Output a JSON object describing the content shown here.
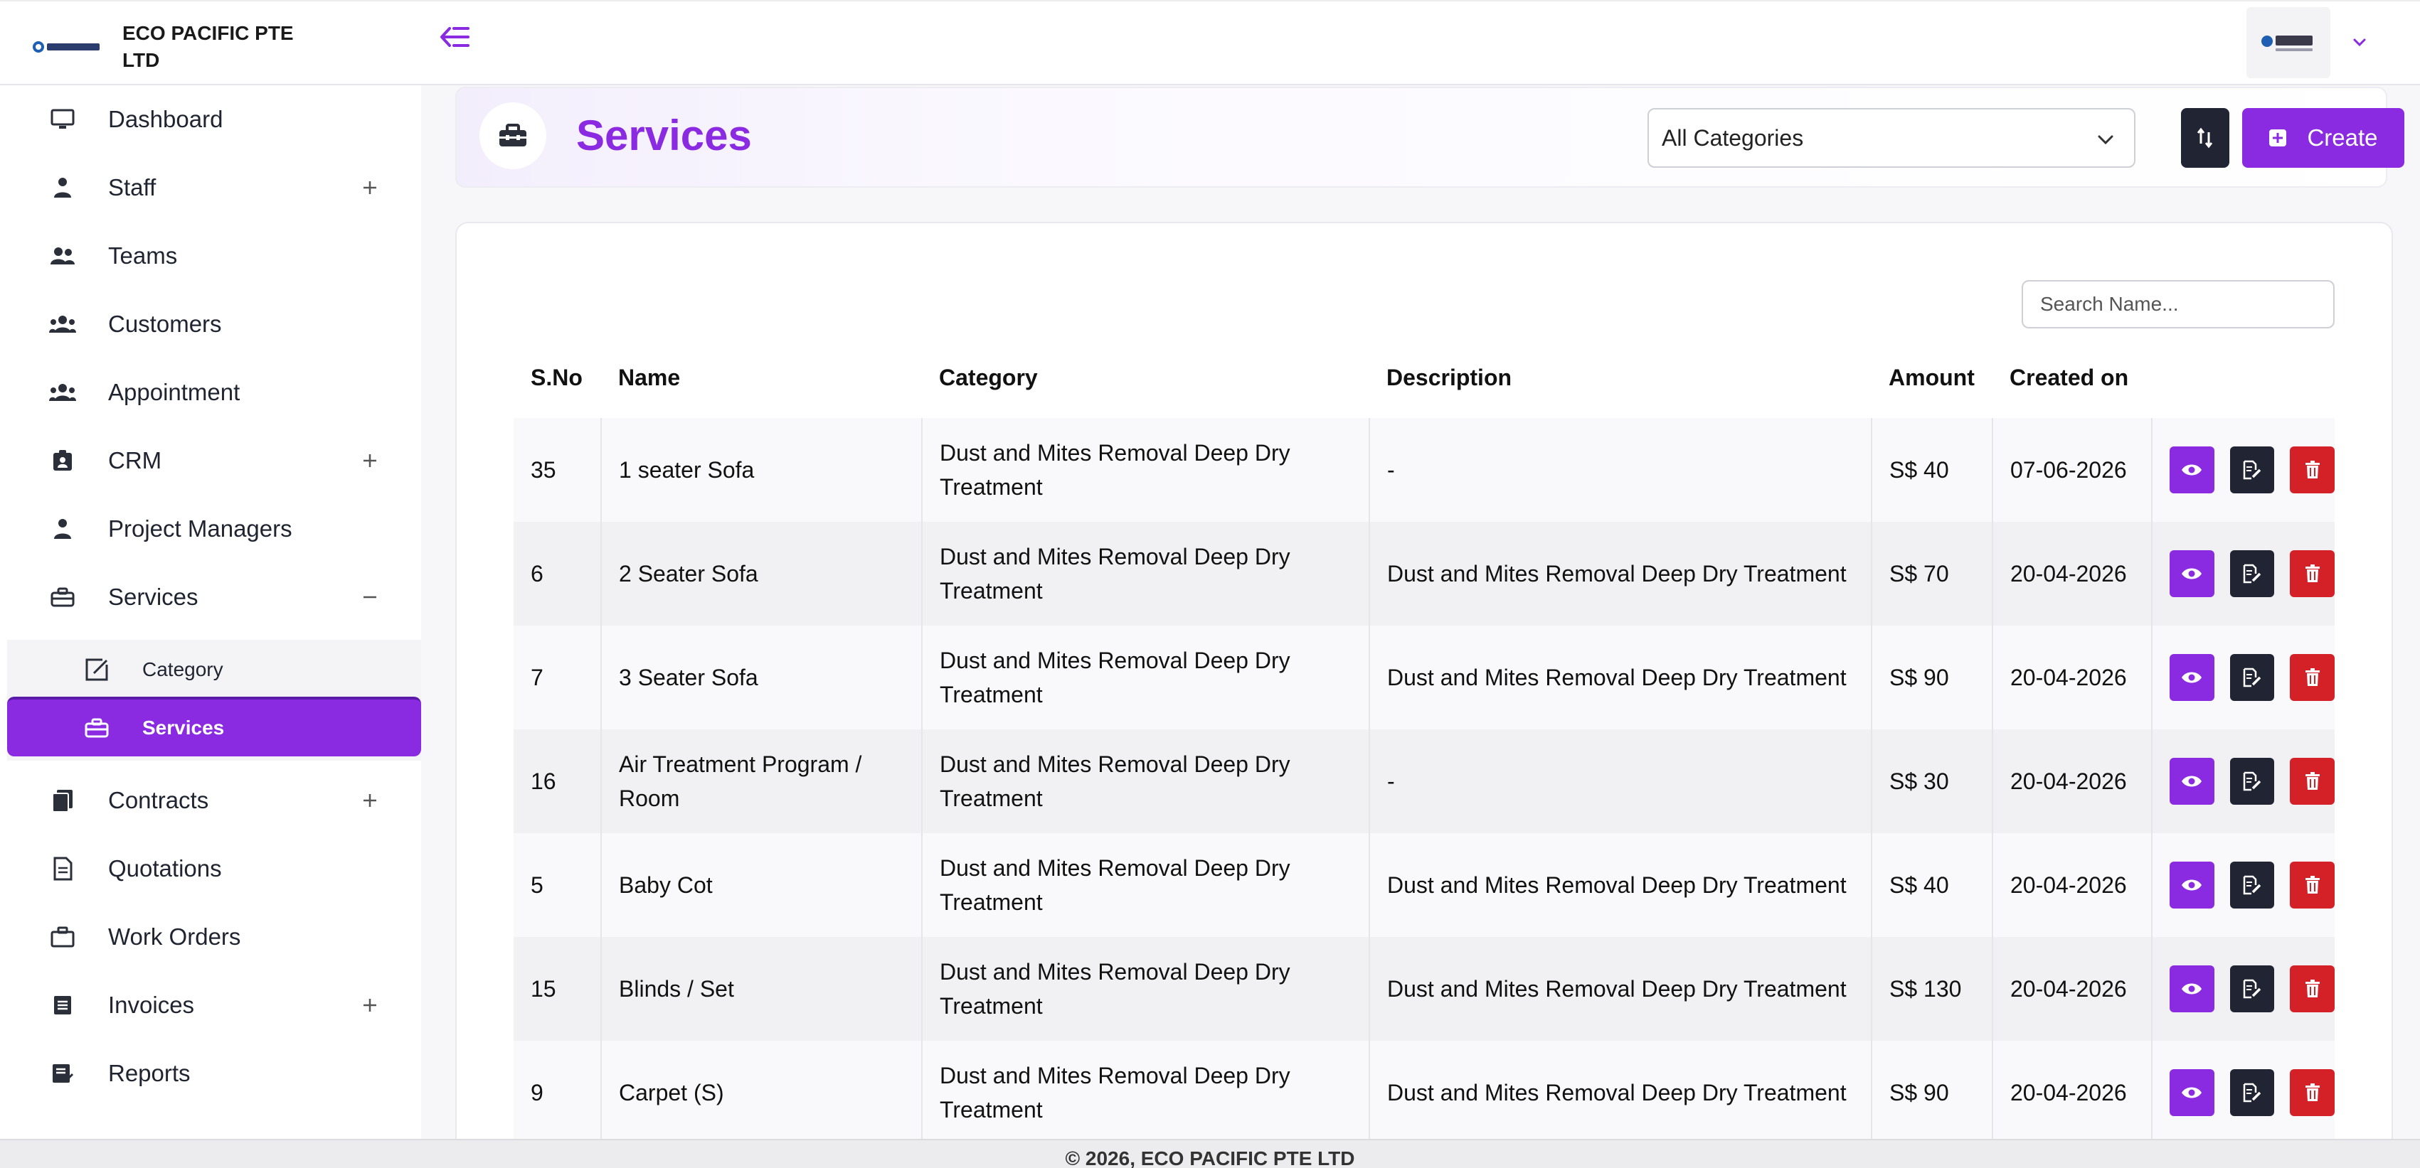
{
  "brand": {
    "name": "ECO PACIFIC PTE LTD"
  },
  "sidebar": {
    "items": [
      {
        "label": "Dashboard",
        "icon": "monitor-icon"
      },
      {
        "label": "Staff",
        "icon": "person-icon",
        "toggle": "+"
      },
      {
        "label": "Teams",
        "icon": "people-icon"
      },
      {
        "label": "Customers",
        "icon": "group-icon"
      },
      {
        "label": "Appointment",
        "icon": "group-icon"
      },
      {
        "label": "CRM",
        "icon": "id-badge-icon",
        "toggle": "+"
      },
      {
        "label": "Project Managers",
        "icon": "person-icon"
      },
      {
        "label": "Services",
        "icon": "toolbox-icon",
        "toggle": "−"
      },
      {
        "label": "Contracts",
        "icon": "documents-icon",
        "toggle": "+"
      },
      {
        "label": "Quotations",
        "icon": "file-icon"
      },
      {
        "label": "Work Orders",
        "icon": "briefcase-icon"
      },
      {
        "label": "Invoices",
        "icon": "list-icon",
        "toggle": "+"
      },
      {
        "label": "Reports",
        "icon": "report-icon"
      }
    ],
    "submenu": [
      {
        "label": "Category",
        "icon": "edit-square-icon"
      },
      {
        "label": "Services",
        "icon": "toolbox-icon",
        "active": true
      }
    ]
  },
  "header": {
    "title": "Services",
    "category_select": {
      "value": "All Categories"
    },
    "create_label": "Create"
  },
  "search": {
    "placeholder": "Search Name..."
  },
  "table": {
    "columns": [
      "S.No",
      "Name",
      "Category",
      "Description",
      "Amount",
      "Created on"
    ],
    "rows": [
      {
        "sno": "35",
        "name": "1 seater Sofa",
        "category": "Dust and Mites Removal Deep Dry Treatment",
        "description": "-",
        "amount": "S$ 40",
        "created": "07-06-2026"
      },
      {
        "sno": "6",
        "name": "2 Seater Sofa",
        "category": "Dust and Mites Removal Deep Dry Treatment",
        "description": "Dust and Mites Removal Deep Dry Treatment",
        "amount": "S$ 70",
        "created": "20-04-2026"
      },
      {
        "sno": "7",
        "name": "3 Seater Sofa",
        "category": "Dust and Mites Removal Deep Dry Treatment",
        "description": "Dust and Mites Removal Deep Dry Treatment",
        "amount": "S$ 90",
        "created": "20-04-2026"
      },
      {
        "sno": "16",
        "name": "Air Treatment Program / Room",
        "category": "Dust and Mites Removal Deep Dry Treatment",
        "description": "-",
        "amount": "S$ 30",
        "created": "20-04-2026"
      },
      {
        "sno": "5",
        "name": "Baby Cot",
        "category": "Dust and Mites Removal Deep Dry Treatment",
        "description": "Dust and Mites Removal Deep Dry Treatment",
        "amount": "S$ 40",
        "created": "20-04-2026"
      },
      {
        "sno": "15",
        "name": "Blinds / Set",
        "category": "Dust and Mites Removal Deep Dry Treatment",
        "description": "Dust and Mites Removal Deep Dry Treatment",
        "amount": "S$ 130",
        "created": "20-04-2026"
      },
      {
        "sno": "9",
        "name": "Carpet (S)",
        "category": "Dust and Mites Removal Deep Dry Treatment",
        "description": "Dust and Mites Removal Deep Dry Treatment",
        "amount": "S$ 90",
        "created": "20-04-2026"
      }
    ]
  },
  "footer": {
    "text": "© 2026, ECO PACIFIC PTE LTD"
  },
  "colors": {
    "accent": "#8a2be2",
    "dark": "#212533",
    "danger": "#d42027"
  }
}
